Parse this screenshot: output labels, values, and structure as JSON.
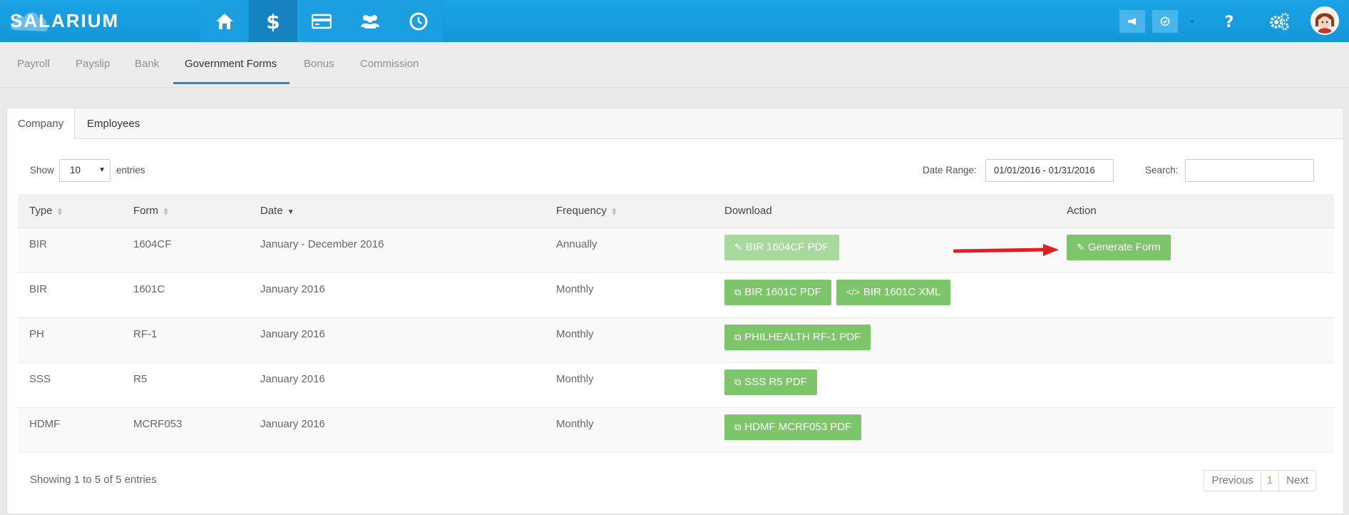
{
  "app": {
    "logo": "SALARIUM"
  },
  "topnav": {
    "items": [
      {
        "name": "home",
        "icon": "home-icon"
      },
      {
        "name": "payroll",
        "icon": "dollar-icon"
      },
      {
        "name": "loans",
        "icon": "credit-card-icon"
      },
      {
        "name": "employees",
        "icon": "users-icon"
      },
      {
        "name": "time",
        "icon": "clock-icon"
      }
    ],
    "active": "payroll"
  },
  "subnav": {
    "items": [
      "Payroll",
      "Payslip",
      "Bank",
      "Government Forms",
      "Bonus",
      "Commission"
    ],
    "active": "Government Forms"
  },
  "tabs": [
    "Company",
    "Employees"
  ],
  "controls": {
    "show_label": "Show",
    "entries_value": "10",
    "entries_label": "entries",
    "date_range_label": "Date Range:",
    "date_range_value": "01/01/2016 - 01/31/2016",
    "search_label": "Search:",
    "search_value": ""
  },
  "table": {
    "headers": [
      "Type",
      "Form",
      "Date",
      "Frequency",
      "Download",
      "Action"
    ],
    "rows": [
      {
        "type": "BIR",
        "form": "1604CF",
        "date": "January - December 2016",
        "frequency": "Annually",
        "downloads": [
          "BIR 1604CF PDF"
        ],
        "action": "Generate Form"
      },
      {
        "type": "BIR",
        "form": "1601C",
        "date": "January 2016",
        "frequency": "Monthly",
        "downloads": [
          "BIR 1601C PDF",
          "BIR 1601C XML"
        ],
        "action": ""
      },
      {
        "type": "PH",
        "form": "RF-1",
        "date": "January 2016",
        "frequency": "Monthly",
        "downloads": [
          "PHILHEALTH RF-1 PDF"
        ],
        "action": ""
      },
      {
        "type": "SSS",
        "form": "R5",
        "date": "January 2016",
        "frequency": "Monthly",
        "downloads": [
          "SSS R5 PDF"
        ],
        "action": ""
      },
      {
        "type": "HDMF",
        "form": "MCRF053",
        "date": "January 2016",
        "frequency": "Monthly",
        "downloads": [
          "HDMF MCRF053 PDF"
        ],
        "action": ""
      }
    ]
  },
  "footer": {
    "info": "Showing 1 to 5 of 5 entries",
    "previous": "Previous",
    "page": "1",
    "next": "Next"
  },
  "colors": {
    "topbar": "#1ba1e2",
    "accent_green": "#7dc56a",
    "arrow": "#e02020"
  }
}
